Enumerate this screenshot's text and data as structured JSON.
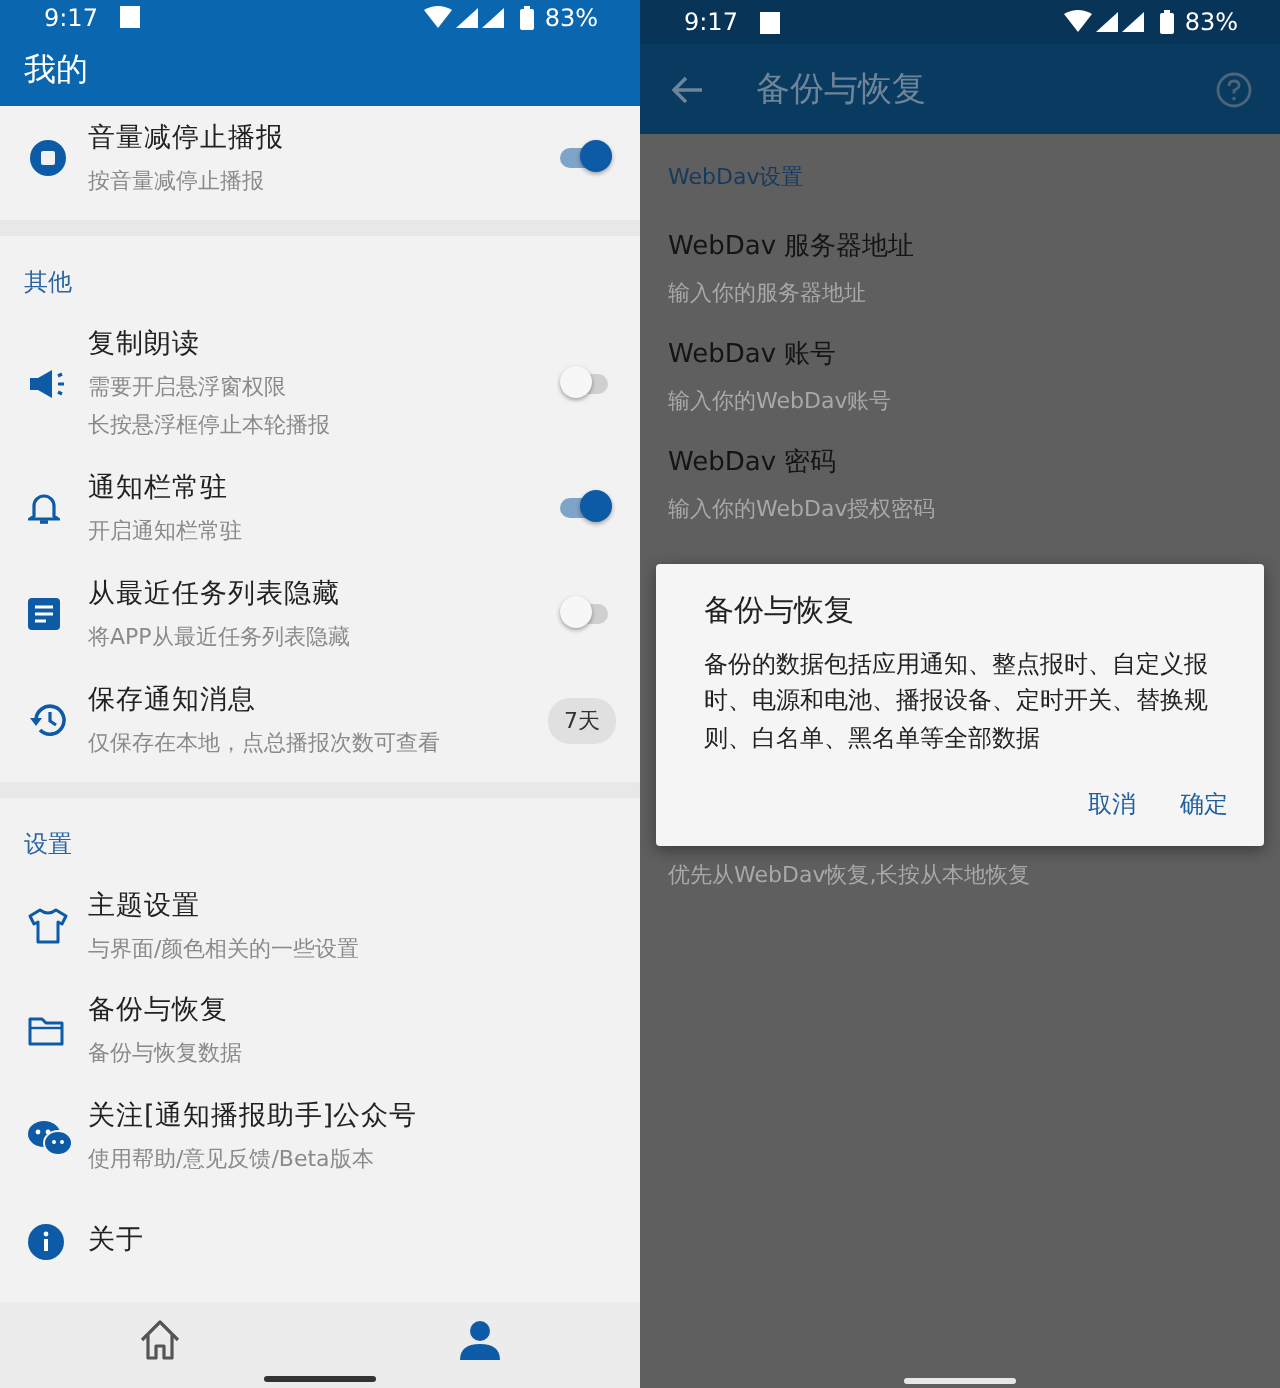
{
  "left": {
    "status_bar": {
      "time": "9:17",
      "battery": "83%"
    },
    "app_bar": {
      "title": "我的"
    },
    "sections": [
      {
        "items": [
          {
            "kind": "toggle",
            "title": "音量减停止播报",
            "subtitle": "按音量减停止播报",
            "on": true
          }
        ]
      },
      {
        "header": "其他",
        "items": [
          {
            "kind": "toggle",
            "title": "复制朗读",
            "subtitle": [
              "需要开启悬浮窗权限",
              "长按悬浮框停止本轮播报"
            ],
            "on": false
          },
          {
            "kind": "toggle",
            "title": "通知栏常驻",
            "subtitle": "开启通知栏常驻",
            "on": true
          },
          {
            "kind": "toggle",
            "title": "从最近任务列表隐藏",
            "subtitle": "将APP从最近任务列表隐藏",
            "on": false
          },
          {
            "kind": "chip",
            "title": "保存通知消息",
            "subtitle": "仅保存在本地，点总播报次数可查看",
            "value": "7天"
          }
        ]
      },
      {
        "header": "设置",
        "items": [
          {
            "kind": "plain",
            "title": "主题设置",
            "subtitle": "与界面/颜色相关的一些设置"
          },
          {
            "kind": "plain",
            "title": "备份与恢复",
            "subtitle": "备份与恢复数据"
          },
          {
            "kind": "plain",
            "title": "关注[通知播报助手]公众号",
            "subtitle": "使用帮助/意见反馈/Beta版本"
          },
          {
            "kind": "plain",
            "title": "关于"
          }
        ]
      }
    ],
    "bottom_nav": [
      {
        "selected": false
      },
      {
        "selected": true
      }
    ]
  },
  "right": {
    "status_bar": {
      "time": "9:17",
      "battery": "83%"
    },
    "app_bar": {
      "title": "备份与恢复"
    },
    "section_header": "WebDav设置",
    "items": [
      {
        "title": "WebDav 服务器地址",
        "subtitle": "输入你的服务器地址"
      },
      {
        "title": "WebDav 账号",
        "subtitle": "输入你的WebDav账号"
      },
      {
        "title": "WebDav 密码",
        "subtitle": "输入你的WebDav授权密码"
      }
    ],
    "covered_item_subtitle": "优先从WebDav恢复,长按从本地恢复",
    "dialog": {
      "title": "备份与恢复",
      "message": "备份的数据包括应用通知、整点报时、自定义报时、电源和电池、播报设备、定时开关、替换规则、白名单、黑名单等全部数据",
      "buttons": [
        "取消",
        "确定"
      ]
    }
  }
}
